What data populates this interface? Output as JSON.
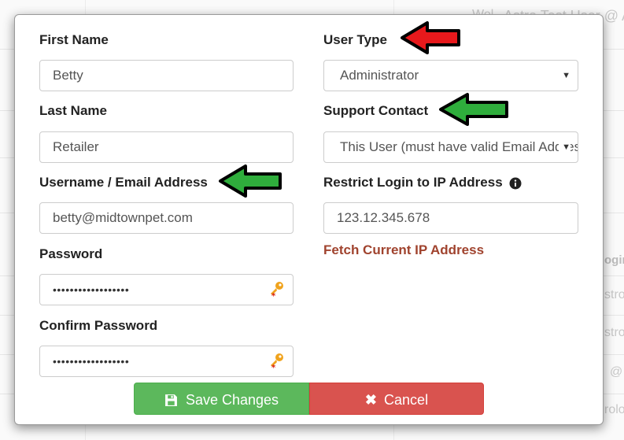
{
  "background": {
    "top_right_text": "Astro Test User @ A",
    "top_right_prefix": "Wel",
    "side_texts": [
      "ogin",
      "stro",
      "stro",
      "@",
      "rolo"
    ]
  },
  "form": {
    "first_name": {
      "label": "First Name",
      "value": "Betty"
    },
    "last_name": {
      "label": "Last Name",
      "value": "Retailer"
    },
    "username": {
      "label": "Username / Email Address",
      "value": "betty@midtownpet.com"
    },
    "password": {
      "label": "Password",
      "value": "••••••••••••••••••"
    },
    "confirm_password": {
      "label": "Confirm Password",
      "value": "••••••••••••••••••"
    },
    "user_type": {
      "label": "User Type",
      "selected": "Administrator"
    },
    "support_contact": {
      "label": "Support Contact",
      "selected": "This User (must have valid Email Address)"
    },
    "restrict_ip": {
      "label": "Restrict Login to IP Address",
      "value": "123.12.345.678"
    },
    "fetch_ip_link": "Fetch Current IP Address"
  },
  "buttons": {
    "save_label": "Save Changes",
    "cancel_label": "Cancel"
  },
  "annotations": {
    "arrow_red_color": "#e8191c",
    "arrow_green_color": "#2fad3c"
  },
  "colors": {
    "save": "#5cb85c",
    "cancel": "#d9534f",
    "link": "#a0432e"
  }
}
